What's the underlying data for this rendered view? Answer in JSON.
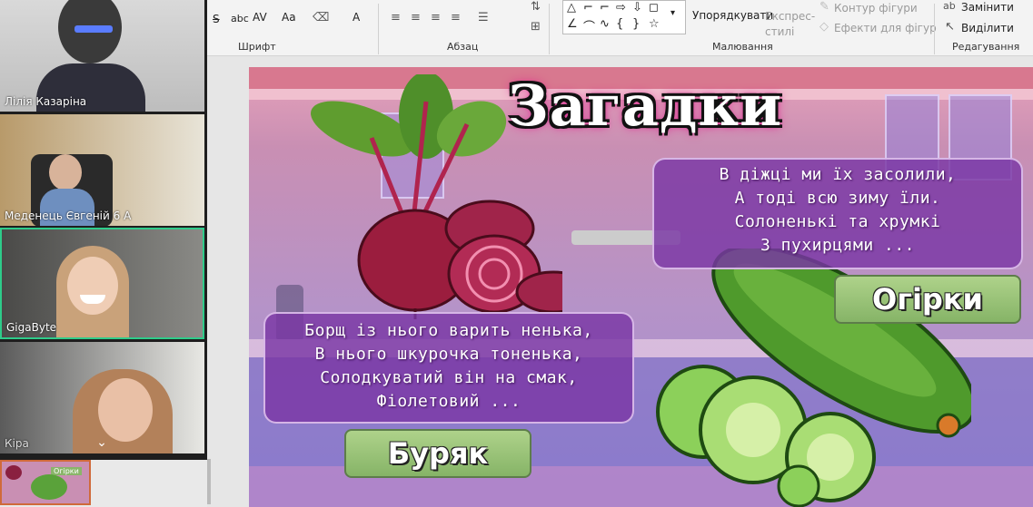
{
  "ribbon": {
    "font_group_label": "Шрифт",
    "paragraph_group_label": "Абзац",
    "drawing_group_label": "Малювання",
    "editing_group_label": "Редагування",
    "arrange_label": "Упорядкувати",
    "quick_styles_label": "Експрес-стилі",
    "shape_outline_label": "Контур фігури",
    "shape_effects_label": "Ефекти для фігур",
    "replace_label": "Замінити",
    "select_label": "Виділити",
    "font_btn_s": "S",
    "font_btn_abc": "abc",
    "font_btn_av": "AV",
    "font_btn_aa": "Aa",
    "font_btn_a": "A"
  },
  "video": {
    "participants": [
      {
        "name": "Лілія Казаріна"
      },
      {
        "name": "Меденець Євгеній 6 А"
      },
      {
        "name": "GigaByte"
      },
      {
        "name": "Кіра"
      }
    ]
  },
  "slide": {
    "title": "Загадки",
    "riddle_beet": {
      "lines": [
        "Борщ із нього варить ненька,",
        "В нього шкурочка тоненька,",
        "Солодкуватий він на смак,",
        "Фіолетовий ..."
      ]
    },
    "answer_beet": "Буряк",
    "riddle_cucumber": {
      "lines": [
        "В діжці ми їх засолили,",
        "А тоді всю зиму їли.",
        "Солоненькі та хрумкі",
        "З пухирцями ..."
      ]
    },
    "answer_cucumber": "Огірки"
  },
  "thumbnail": {
    "label": "Огірки"
  },
  "colors": {
    "active_tile_border": "#2ecc8a",
    "title_glow": "#e0108a",
    "riddle_bg": "#7a37a5",
    "answer_bg": "#9cc47a"
  }
}
